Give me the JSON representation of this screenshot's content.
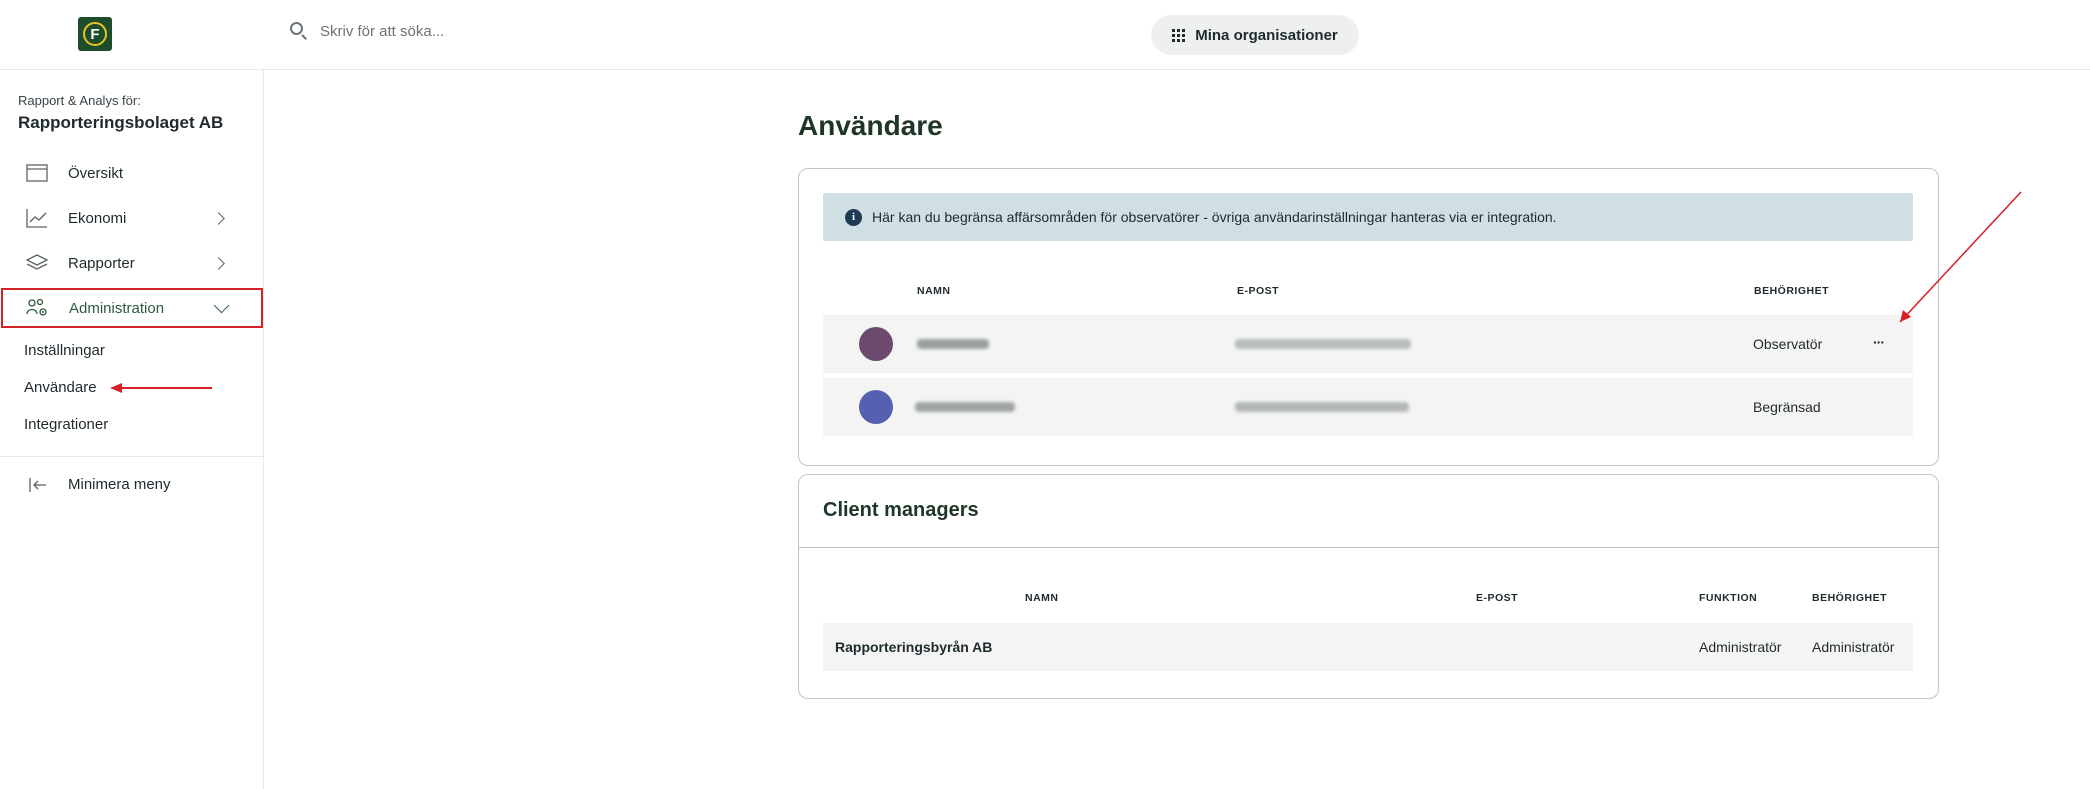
{
  "header": {
    "logo_letter": "F",
    "search_placeholder": "Skriv för att söka...",
    "orgs_button": "Mina organisationer"
  },
  "sidebar": {
    "subtitle": "Rapport & Analys för:",
    "company": "Rapporteringsbolaget AB",
    "items": [
      {
        "label": "Översikt",
        "icon": "window-icon"
      },
      {
        "label": "Ekonomi",
        "icon": "chart-line-icon"
      },
      {
        "label": "Rapporter",
        "icon": "layers-icon"
      },
      {
        "label": "Administration",
        "icon": "users-gear-icon"
      }
    ],
    "admin_sub": [
      "Inställningar",
      "Användare",
      "Integrationer"
    ],
    "minimize": "Minimera meny"
  },
  "main": {
    "title": "Användare",
    "info": "Här kan du begränsa affärsområden för observatörer - övriga användarinställningar hanteras via er integration.",
    "users_table": {
      "headers": [
        "NAMN",
        "E-POST",
        "BEHÖRIGHET"
      ],
      "rows": [
        {
          "permission": "Observatör",
          "more": "···"
        },
        {
          "permission": "Begränsad"
        }
      ]
    },
    "client_managers": {
      "title": "Client managers",
      "headers": [
        "NAMN",
        "E-POST",
        "FUNKTION",
        "BEHÖRIGHET"
      ],
      "rows": [
        {
          "name": "Rapporteringsbyrån AB",
          "function": "Administratör",
          "permission": "Administratör"
        }
      ]
    }
  },
  "colors": {
    "accent_green": "#2e5a3a",
    "highlight_red": "#d42027",
    "info_bg": "#cfdfe3"
  }
}
